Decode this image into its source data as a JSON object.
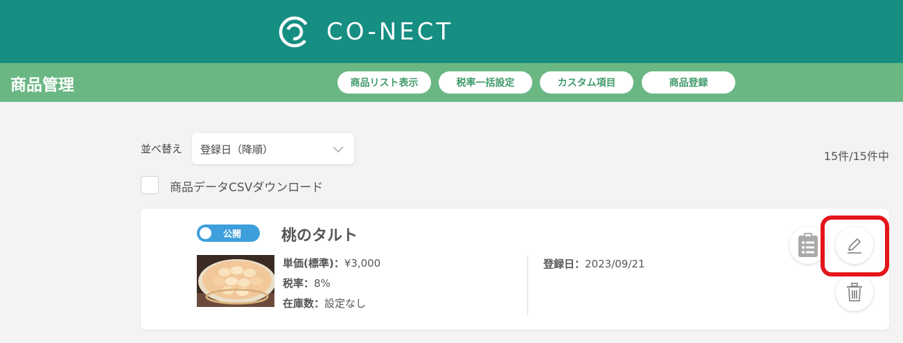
{
  "header": {
    "logo_text": "CO-NECT",
    "brand_color": "#168e82"
  },
  "subheader": {
    "title": "商品管理",
    "bar_color": "#6ab784",
    "nav": [
      {
        "label": "商品リスト表示"
      },
      {
        "label": "税率一括設定"
      },
      {
        "label": "カスタム項目"
      },
      {
        "label": "商品登録"
      }
    ]
  },
  "toolbar": {
    "sort_label": "並べ替え",
    "sort_value": "登録日（降順）",
    "count_text": "15件/15件中",
    "csv_label": "商品データCSVダウンロード"
  },
  "product": {
    "status_label": "公開",
    "name": "桃のタルト",
    "price_label": "単価(標準)：",
    "price_value": "¥3,000",
    "tax_label": "税率：",
    "tax_value": "8%",
    "stock_label": "在庫数：",
    "stock_value": "設定なし",
    "date_label": "登録日：",
    "date_value": "2023/09/21"
  },
  "icons": {
    "logo": "conect-logo-icon",
    "sort": "chevron-down-icon",
    "list": "clipboard-list-icon",
    "edit": "pencil-icon",
    "delete": "trash-icon"
  },
  "highlight_color": "#e3151b"
}
